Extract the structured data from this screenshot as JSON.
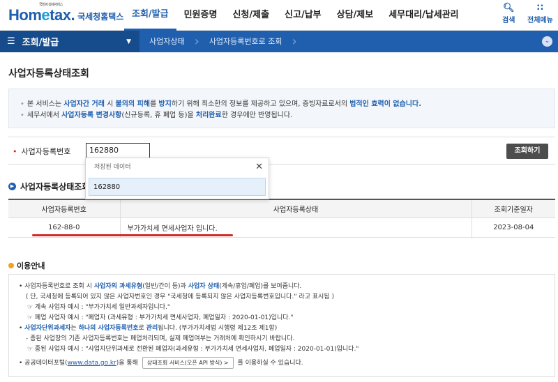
{
  "header": {
    "logo_tag": "국민의 성세서비스",
    "logo_main_a": "Hom",
    "logo_main_e": "e",
    "logo_main_b": "tax.",
    "logo_sub": "국세청홈택스",
    "nav": [
      "조회/발급",
      "민원증명",
      "신청/제출",
      "신고/납부",
      "상담/제보",
      "세무대리/납세관리"
    ],
    "search_label": "검색",
    "menu_label": "전체메뉴"
  },
  "subnav": {
    "menu_label": "조회/발급",
    "crumbs": [
      "사업자상태",
      "사업자등록번호로 조회"
    ]
  },
  "page": {
    "title": "사업자등록상태조회"
  },
  "notice": {
    "line1": {
      "t1": "본 서비스는 ",
      "b1": "사업자간 거래",
      "t2": " 시 ",
      "b2": "불의의 피해",
      "t3": "를 ",
      "b3": "방지",
      "t4": "하기 위해 최소한의 정보를 제공하고 있으며, 증빙자료로서의 ",
      "b4": "법적인 효력이 없습니다."
    },
    "line2": {
      "t1": "세무서에서 ",
      "b1": "사업자등록 변경사항",
      "t2": "(신규등록, 휴 폐업 등)을 ",
      "b2": "처리완료",
      "t3": "한 경우에만 반영됩니다."
    }
  },
  "search": {
    "label": "사업자등록번호",
    "value": "162880",
    "button": "조회하기"
  },
  "autocomplete": {
    "header": "저장된 데이터",
    "item": "162880"
  },
  "result": {
    "title": "사업자등록상태조회",
    "headers": [
      "사업자등록번호",
      "사업자등록상태",
      "조회기준일자"
    ],
    "row": {
      "number": "162-88-0",
      "status": "부가가치세 면세사업자 입니다.",
      "date": "2023-08-04"
    }
  },
  "info": {
    "title": "이용안내",
    "l1": {
      "t1": "사업자등록번호로 조회 시 ",
      "b1": "사업자의 과세유형",
      "t2": "(일반/간이 등)과 ",
      "b2": "사업자 상태",
      "t3": "(계속/휴업/폐업)를 보여줍니다."
    },
    "l2": "( 단, 국세청에 등록되어 있지 않은 사업자번호인 경우 \"국세청에 등록되지 않은 사업자등록번호입니다.\" 라고 표시됨 )",
    "l3": "☞ 계속 사업자 예시 : \"부가가치세 일반과세자입니다.\"",
    "l4": "☞ 폐업 사업자 예시 : \"폐업자 (과세유형 : 부가가치세 면세사업자, 폐업일자 : 2020-01-01)입니다.\"",
    "l5": {
      "b1": "사업자단위과세자",
      "t1": "는 ",
      "b2": "하나의 사업자등록번호",
      "t2": "로 ",
      "b3": "관리",
      "t3": "됩니다. (부가가치세법 시행령 제12조 제1항)"
    },
    "l6": "- 종된 사업장의 기존 사업자등록번호는 폐업처리되며, 실제 폐업여부는 거래처에 확인하시기 바랍니다.",
    "l7": "☞ 종된 사업자 예시 : \"사업자단위과세로 전환된 폐업자(과세유형 : 부가가치세 면세사업자, 폐업일자 : 2020-01-01)입니다.\"",
    "l8": {
      "t1": "공공데이터포털(",
      "link": "www.data.go.kr",
      "t2": ")을 통해 ",
      "btn": "상태조회 서비스(오픈 API 방식) >",
      "t3": " 를 이용하실 수 있습니다."
    }
  }
}
